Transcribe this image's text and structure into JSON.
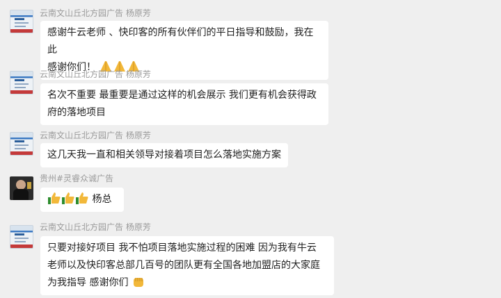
{
  "messages": [
    {
      "sender": "云南文山丘北方园广告   杨原芳",
      "lines": [
        "感谢牛云老师 、快印客的所有伙伴们的平日指导和鼓励，我在此",
        "感谢你们！"
      ],
      "emoji": "pray-icon ×3"
    },
    {
      "sender": "云南文山丘北方园广告   杨原芳",
      "lines": [
        "名次不重要  最重要是通过这样的机会展示  我们更有机会获得政",
        "府的落地项目"
      ]
    },
    {
      "sender": "云南文山丘北方园广告   杨原芳",
      "lines": [
        "这几天我一直和相关领导对接着项目怎么落地实施方案"
      ]
    },
    {
      "sender": "贵州#灵睿众诚广告",
      "lines": [
        "杨总"
      ],
      "emoji": "thumbs-up-icon ×3"
    },
    {
      "sender": "云南文山丘北方园广告   杨原芳",
      "lines": [
        "只要对接好项目   我不怕项目落地实施过程的困难   因为我有牛云",
        "老师以及快印客总部几百号的团队更有全国各地加盟店的大家庭",
        "为我指导   感谢你们"
      ],
      "emoji": "fist-icon"
    }
  ]
}
